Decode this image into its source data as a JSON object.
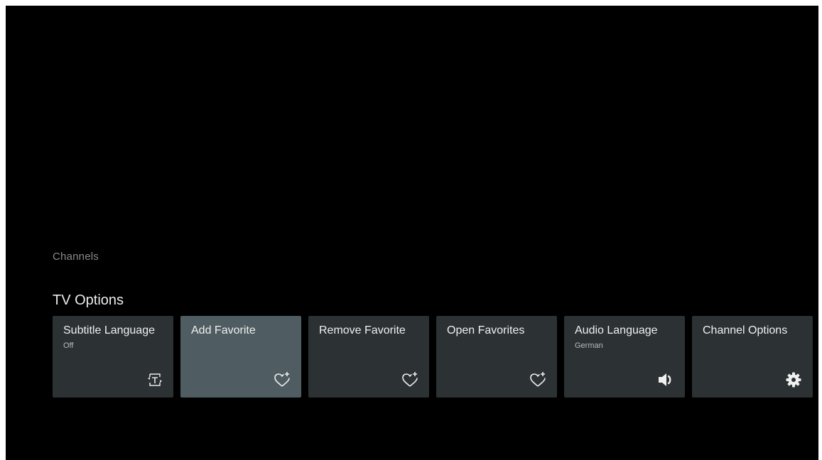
{
  "section": {
    "label": "Channels"
  },
  "row": {
    "title": "TV Options"
  },
  "cards": [
    {
      "title": "Subtitle Language",
      "subtitle": "Off",
      "icon": "subtitle-icon"
    },
    {
      "title": "Add Favorite",
      "subtitle": "",
      "icon": "heart-plus-icon",
      "focused": true
    },
    {
      "title": "Remove Favorite",
      "subtitle": "",
      "icon": "heart-plus-icon"
    },
    {
      "title": "Open Favorites",
      "subtitle": "",
      "icon": "heart-plus-icon"
    },
    {
      "title": "Audio Language",
      "subtitle": "German",
      "icon": "speaker-icon"
    },
    {
      "title": "Channel Options",
      "subtitle": "",
      "icon": "gear-icon"
    }
  ],
  "colors": {
    "background": "#000000",
    "card": "#2c3134",
    "card_focused": "#4f5d62",
    "text": "#f0f0f0",
    "label_dim": "#8a8a8a"
  }
}
